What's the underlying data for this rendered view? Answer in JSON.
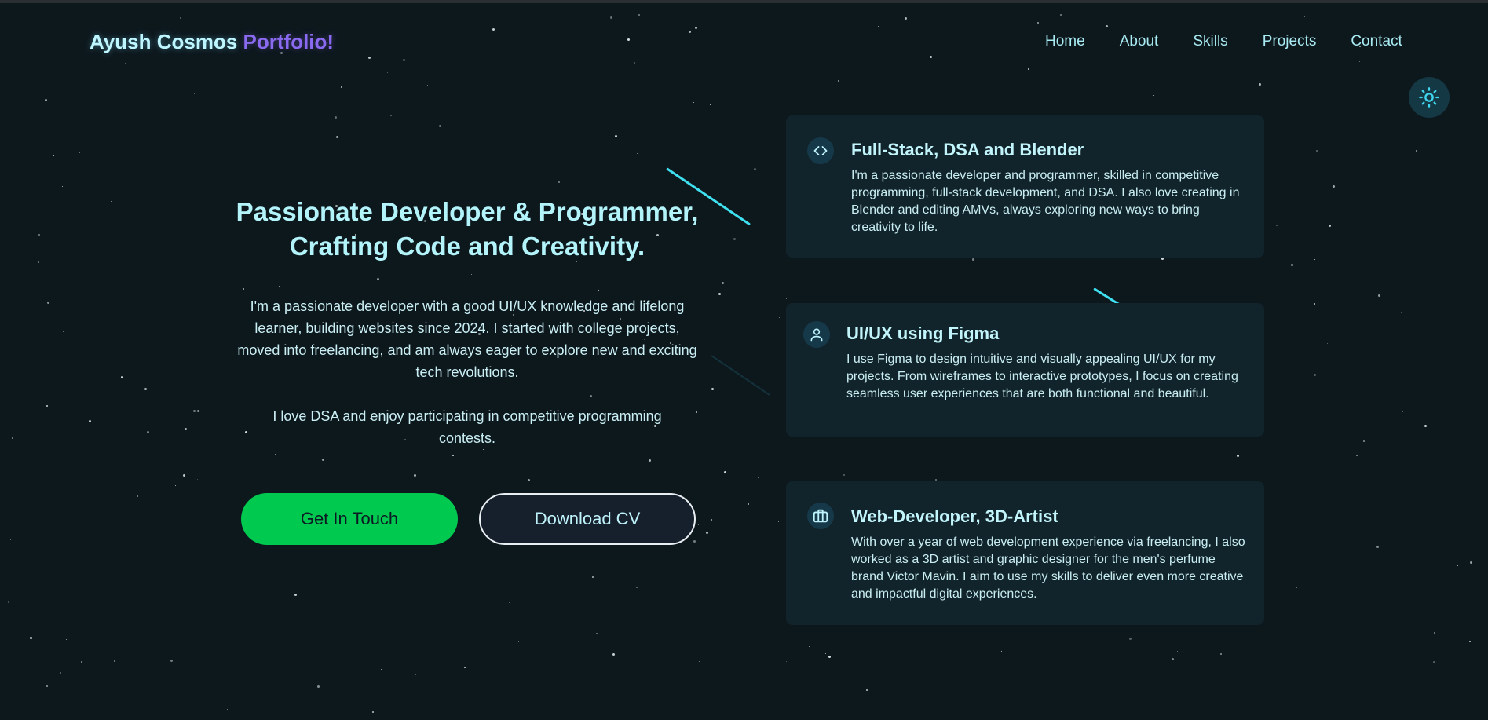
{
  "header": {
    "logo_name": "Ayush Cosmos",
    "logo_accent": "Portfolio!",
    "nav": [
      "Home",
      "About",
      "Skills",
      "Projects",
      "Contact"
    ]
  },
  "theme_toggle": {
    "icon": "sun-icon"
  },
  "hero": {
    "heading_line1": "Passionate Developer & Programmer,",
    "heading_line2": "Crafting Code and Creativity.",
    "paragraph1": "I'm a passionate developer with a good UI/UX knowledge and lifelong learner, building websites since 2024. I started with college projects, moved into freelancing, and am always eager to explore new and exciting tech revolutions.",
    "paragraph2": "I love DSA and enjoy participating in competitive programming contests.",
    "primary_button": "Get In Touch",
    "secondary_button": "Download CV"
  },
  "cards": [
    {
      "icon": "code-icon",
      "title": "Full-Stack, DSA and Blender",
      "text": "I'm a passionate developer and programmer, skilled in competitive programming, full-stack development, and DSA. I also love creating in Blender and editing AMVs, always exploring new ways to bring creativity to life."
    },
    {
      "icon": "user-icon",
      "title": "UI/UX using Figma",
      "text": "I use Figma to design intuitive and visually appealing UI/UX for my projects. From wireframes to interactive prototypes, I focus on creating seamless user experiences that are both functional and beautiful."
    },
    {
      "icon": "briefcase-icon",
      "title": "Web-Developer, 3D-Artist",
      "text": "With over a year of web development experience via freelancing, I also worked as a 3D artist and graphic designer for the men's perfume brand Victor Mavin. I aim to use my skills to deliver even more creative and impactful digital experiences."
    }
  ],
  "colors": {
    "background": "#0d181d",
    "accent_cyan": "#3fe0f0",
    "logo_accent": "#8a6af0",
    "primary_button": "#00c950",
    "card": "#12242b"
  }
}
